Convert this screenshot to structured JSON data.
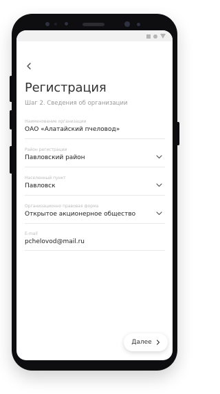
{
  "screen": {
    "title": "Регистрация",
    "subtitle": "Шаг 2. Сведения об организации"
  },
  "form": {
    "fields": [
      {
        "label": "Наименование организации",
        "value": "ОАО «Алатайский пчеловод»",
        "type": "text"
      },
      {
        "label": "Район регистрации",
        "value": "Павловский район",
        "type": "select"
      },
      {
        "label": "Населенный пункт",
        "value": "Павловск",
        "type": "select"
      },
      {
        "label": "Организационно правовая форма",
        "value": "Открытое акционерное общество",
        "type": "select"
      },
      {
        "label": "E-mail",
        "value": "pchelovod@mail.ru",
        "type": "text"
      }
    ]
  },
  "actions": {
    "next_label": "Далее"
  },
  "icons": {
    "back": "back-arrow-icon",
    "dropdown": "chevron-down-icon",
    "next": "chevron-right-icon"
  },
  "colors": {
    "text": "#333333",
    "label": "#bdbdbd",
    "divider": "#e8e8e8",
    "device": "#0e0e10"
  }
}
